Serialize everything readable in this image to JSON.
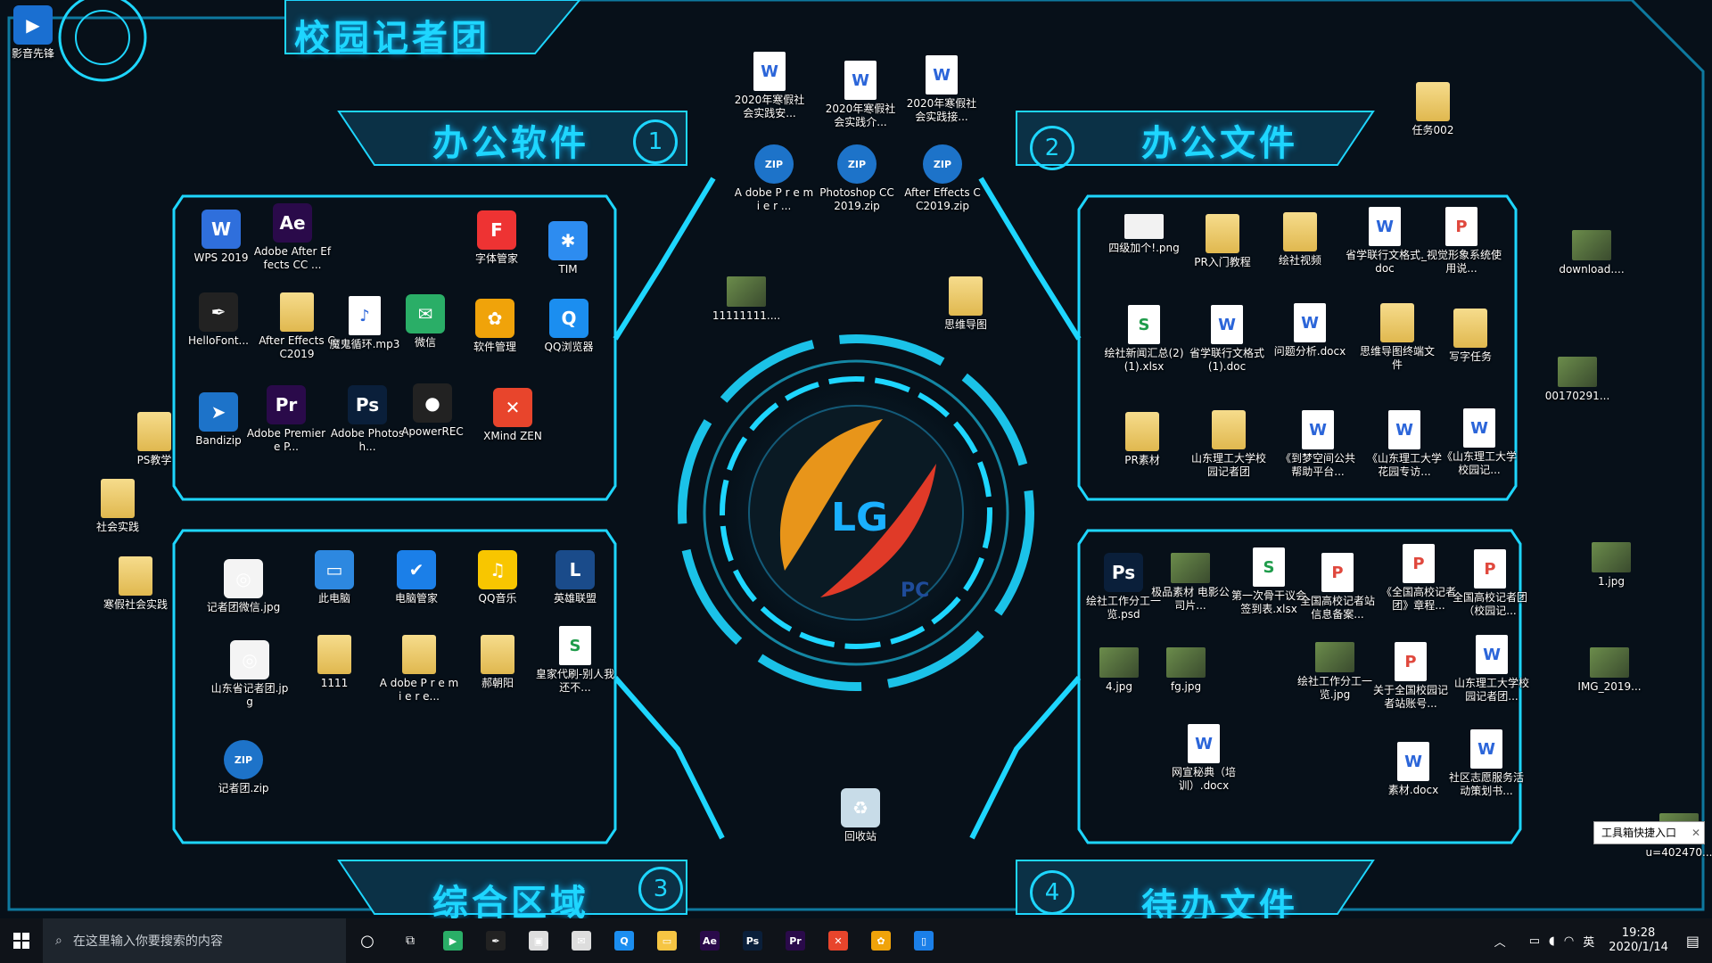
{
  "wallpaper": {
    "title_top": "校园记者团",
    "section1": {
      "title": "办公软件",
      "num": "1"
    },
    "section2": {
      "title": "办公文件",
      "num": "2"
    },
    "section3": {
      "title": "综合区域",
      "num": "3"
    },
    "section4": {
      "title": "待办文件",
      "num": "4"
    },
    "logo_mark": "LG",
    "logo_sub": "PC",
    "accent": "#1ed6ff"
  },
  "icons": [
    {
      "id": "yingyin",
      "label": "影音先锋",
      "kind": "app",
      "color": "#1a6fd1",
      "glyph": "▶"
    },
    {
      "id": "wps",
      "label": "WPS 2019",
      "kind": "app",
      "color": "#2f6fdc",
      "glyph": "W"
    },
    {
      "id": "ae",
      "label": "Adobe After Effects CC ...",
      "kind": "app",
      "color": "#2a0a4a",
      "glyph": "Ae"
    },
    {
      "id": "ziti",
      "label": "字体管家",
      "kind": "app",
      "color": "#e33",
      "glyph": "F"
    },
    {
      "id": "tim",
      "label": "TIM",
      "kind": "app",
      "color": "#2d8cf0",
      "glyph": "✱"
    },
    {
      "id": "hellofont",
      "label": "HelloFont...",
      "kind": "app",
      "color": "#222",
      "glyph": "✒"
    },
    {
      "id": "aecc",
      "label": "After Effects CC2019",
      "kind": "folder",
      "glyph": ""
    },
    {
      "id": "mogui",
      "label": "魔鬼循环.mp3",
      "kind": "doc",
      "glyph": "♪"
    },
    {
      "id": "wechat",
      "label": "微信",
      "kind": "app",
      "color": "#2aae67",
      "glyph": "✉"
    },
    {
      "id": "rjgl",
      "label": "软件管理",
      "kind": "app",
      "color": "#f0a30a",
      "glyph": "✿"
    },
    {
      "id": "qqbrowser",
      "label": "QQ浏览器",
      "kind": "app",
      "color": "#1b8ef0",
      "glyph": "Q"
    },
    {
      "id": "bandizip",
      "label": "Bandizip",
      "kind": "app",
      "color": "#1d73c9",
      "glyph": "➤"
    },
    {
      "id": "pr",
      "label": "Adobe Premiere P...",
      "kind": "app",
      "color": "#2a0a4a",
      "glyph": "Pr"
    },
    {
      "id": "ps",
      "label": "Adobe Photosh...",
      "kind": "app",
      "color": "#0a1f3a",
      "glyph": "Ps"
    },
    {
      "id": "apowerrec",
      "label": "ApowerREC",
      "kind": "app",
      "color": "#222",
      "glyph": "●"
    },
    {
      "id": "xmind",
      "label": "XMind ZEN",
      "kind": "app",
      "color": "#e8452c",
      "glyph": "✕"
    },
    {
      "id": "psjx",
      "label": "PS教学",
      "kind": "folder",
      "glyph": ""
    },
    {
      "id": "shsj",
      "label": "社会实践",
      "kind": "folder",
      "glyph": ""
    },
    {
      "id": "hjshsj",
      "label": "寒假社会实践",
      "kind": "folder",
      "glyph": ""
    },
    {
      "id": "jzwx",
      "label": "记者团微信.jpg",
      "kind": "app",
      "color": "#f4f4f4",
      "glyph": "◎"
    },
    {
      "id": "thispc",
      "label": "此电脑",
      "kind": "app",
      "color": "#2d88e0",
      "glyph": "▭"
    },
    {
      "id": "pcmgr",
      "label": "电脑管家",
      "kind": "app",
      "color": "#1b7fe8",
      "glyph": "✔"
    },
    {
      "id": "qqmusic",
      "label": "QQ音乐",
      "kind": "app",
      "color": "#f8c600",
      "glyph": "♫"
    },
    {
      "id": "lol",
      "label": "英雄联盟",
      "kind": "app",
      "color": "#1a4b8a",
      "glyph": "L"
    },
    {
      "id": "sdsjz",
      "label": "山东省记者团.jpg",
      "kind": "app",
      "color": "#f4f4f4",
      "glyph": "◎"
    },
    {
      "id": "f1111",
      "label": "1111",
      "kind": "folder",
      "glyph": ""
    },
    {
      "id": "adobepr2",
      "label": "A dobe P r e m i e r e...",
      "kind": "folder",
      "glyph": ""
    },
    {
      "id": "hcy",
      "label": "郝朝阳",
      "kind": "folder",
      "glyph": ""
    },
    {
      "id": "hjdb",
      "label": "皇家代刷-别人我还不...",
      "kind": "xls",
      "glyph": "S"
    },
    {
      "id": "jztzip",
      "label": "记者团.zip",
      "kind": "zip",
      "glyph": "ZIP"
    },
    {
      "id": "doc2020a",
      "label": "2020年寒假社会实践安...",
      "kind": "doc",
      "glyph": "W"
    },
    {
      "id": "doc2020b",
      "label": "2020年寒假社会实践介...",
      "kind": "doc",
      "glyph": "W"
    },
    {
      "id": "doc2020c",
      "label": "2020年寒假社会实践接...",
      "kind": "doc",
      "glyph": "W"
    },
    {
      "id": "zippr",
      "label": "A dobe P r e m i e r ...",
      "kind": "zip",
      "glyph": "ZIP"
    },
    {
      "id": "zipps",
      "label": "Photoshop CC 2019.zip",
      "kind": "zip",
      "glyph": "ZIP"
    },
    {
      "id": "zipae",
      "label": "After Effects CC2019.zip",
      "kind": "zip",
      "glyph": "ZIP"
    },
    {
      "id": "img1111",
      "label": "11111111....",
      "kind": "img",
      "glyph": ""
    },
    {
      "id": "swdt",
      "label": "思维导图",
      "kind": "folder",
      "glyph": ""
    },
    {
      "id": "rw002",
      "label": "任务002",
      "kind": "folder",
      "glyph": ""
    },
    {
      "id": "sjjg",
      "label": "四级加个!.png",
      "kind": "png",
      "glyph": ""
    },
    {
      "id": "prrm",
      "label": "PR入门教程",
      "kind": "folder",
      "glyph": ""
    },
    {
      "id": "hssp",
      "label": "绘社视频",
      "kind": "folder",
      "glyph": ""
    },
    {
      "id": "sxlh",
      "label": "省学联行文格式.doc",
      "kind": "doc",
      "glyph": "W"
    },
    {
      "id": "sjxx",
      "label": "_视觉形象系统使用说...",
      "kind": "ppt",
      "glyph": "P"
    },
    {
      "id": "download",
      "label": "download....",
      "kind": "img",
      "glyph": ""
    },
    {
      "id": "hsxw",
      "label": "绘社新闻汇总(2)(1).xlsx",
      "kind": "xls",
      "glyph": "S"
    },
    {
      "id": "sxlh1",
      "label": "省学联行文格式(1).doc",
      "kind": "doc",
      "glyph": "W"
    },
    {
      "id": "wtfx",
      "label": "问题分析.docx",
      "kind": "doc",
      "glyph": "W"
    },
    {
      "id": "swdtzz",
      "label": "思维导图终端文件",
      "kind": "folder",
      "glyph": ""
    },
    {
      "id": "xzrw",
      "label": "写字任务",
      "kind": "folder",
      "glyph": ""
    },
    {
      "id": "i00170291",
      "label": "00170291...",
      "kind": "img",
      "glyph": ""
    },
    {
      "id": "prsc",
      "label": "PR素材",
      "kind": "folder",
      "glyph": ""
    },
    {
      "id": "sdlg",
      "label": "山东理工大学校园记者团",
      "kind": "folder",
      "glyph": ""
    },
    {
      "id": "dmkj",
      "label": "《到梦空间公共帮助平台...",
      "kind": "doc",
      "glyph": "W"
    },
    {
      "id": "sdlgzx",
      "label": "《山东理工大学花园专访...",
      "kind": "doc",
      "glyph": "W"
    },
    {
      "id": "sdlgxy",
      "label": "《山东理工大学校园记...",
      "kind": "doc",
      "glyph": "W"
    },
    {
      "id": "hsgz",
      "label": "绘社工作分工一览.psd",
      "kind": "app",
      "color": "#0a1f3a",
      "glyph": "Ps"
    },
    {
      "id": "jpsc",
      "label": "极品素材 电影公司片...",
      "kind": "img",
      "glyph": ""
    },
    {
      "id": "dycsq",
      "label": "第一次骨干议会签到表.xlsx",
      "kind": "xls",
      "glyph": "S"
    },
    {
      "id": "qggx",
      "label": "全国高校记者站信息备案...",
      "kind": "ppt",
      "glyph": "P"
    },
    {
      "id": "qggxzc",
      "label": "《全国高校记者团》章程...",
      "kind": "ppt",
      "glyph": "P"
    },
    {
      "id": "qggxxy",
      "label": "全国高校记者团（校园记...",
      "kind": "ppt",
      "glyph": "P"
    },
    {
      "id": "j1jpg",
      "label": "1.jpg",
      "kind": "img",
      "glyph": ""
    },
    {
      "id": "j4jpg",
      "label": "4.jpg",
      "kind": "img",
      "glyph": ""
    },
    {
      "id": "fgjpg",
      "label": "fg.jpg",
      "kind": "img",
      "glyph": ""
    },
    {
      "id": "hsgzjpg",
      "label": "绘社工作分工一览.jpg",
      "kind": "img",
      "glyph": ""
    },
    {
      "id": "gyqg",
      "label": "关于全国校园记者站账号...",
      "kind": "ppt",
      "glyph": "P"
    },
    {
      "id": "sdlgxy2",
      "label": "山东理工大学校园记者团...",
      "kind": "doc",
      "glyph": "W"
    },
    {
      "id": "img2019",
      "label": "IMG_2019...",
      "kind": "img",
      "glyph": ""
    },
    {
      "id": "wxmd",
      "label": "网宣秘典（培训）.docx",
      "kind": "doc",
      "glyph": "W"
    },
    {
      "id": "scdocx",
      "label": "素材.docx",
      "kind": "doc",
      "glyph": "W"
    },
    {
      "id": "sqzy",
      "label": "社区志愿服务活动策划书...",
      "kind": "doc",
      "glyph": "W"
    },
    {
      "id": "recycle",
      "label": "回收站",
      "kind": "app",
      "color": "#c8dce8",
      "glyph": "♻"
    },
    {
      "id": "u4024",
      "label": "u=402470...",
      "kind": "img",
      "glyph": ""
    }
  ],
  "tooltip": "工具箱快捷入口",
  "taskbar": {
    "search_placeholder": "在这里输入你要搜索的内容",
    "apps": [
      {
        "name": "media-player",
        "glyph": "▶",
        "color": "#2aae67"
      },
      {
        "name": "hellofont",
        "glyph": "✒",
        "color": "#222"
      },
      {
        "name": "store",
        "glyph": "▣",
        "color": "#ddd"
      },
      {
        "name": "mail",
        "glyph": "✉",
        "color": "#ddd"
      },
      {
        "name": "qqbrowser",
        "glyph": "Q",
        "color": "#1b8ef0"
      },
      {
        "name": "explorer",
        "glyph": "▭",
        "color": "#f6c543"
      },
      {
        "name": "ae",
        "glyph": "Ae",
        "color": "#2a0a4a"
      },
      {
        "name": "ps",
        "glyph": "Ps",
        "color": "#0a1f3a"
      },
      {
        "name": "pr",
        "glyph": "Pr",
        "color": "#2a0a4a"
      },
      {
        "name": "xmind",
        "glyph": "✕",
        "color": "#e8452c"
      },
      {
        "name": "software-manager",
        "glyph": "✿",
        "color": "#f0a30a"
      },
      {
        "name": "phone",
        "glyph": "▯",
        "color": "#1b7fe8"
      }
    ],
    "ime": "英",
    "time": "19:28",
    "date": "2020/1/14"
  }
}
